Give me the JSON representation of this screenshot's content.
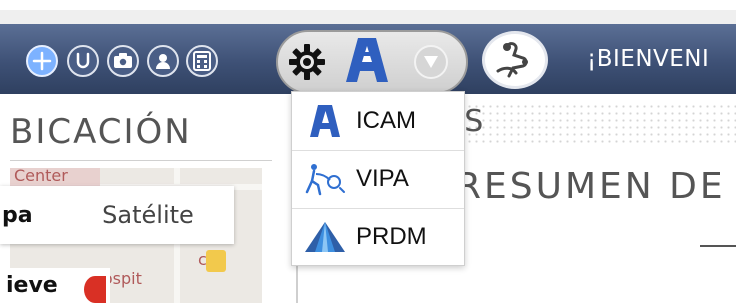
{
  "toolbar": {
    "icons": [
      {
        "name": "add-icon"
      },
      {
        "name": "u-circle-icon"
      },
      {
        "name": "camera-icon"
      },
      {
        "name": "user-icon"
      },
      {
        "name": "calculator-icon"
      }
    ],
    "settings_icon": "gear-icon",
    "logo_icon": "icam-logo-icon",
    "dropdown_icon": "chevron-down-icon",
    "doctor_icon": "doctor-icon",
    "welcome_text": "¡BIENVENI"
  },
  "colors": {
    "navbar_top": "#5b6f95",
    "navbar_bottom": "#2f4060",
    "accent_blue": "#2f5fbf",
    "active_icon": "#7db2ff",
    "menu_text": "#111111"
  },
  "sections": {
    "left_title": "BICACIÓN",
    "right_title": "GS",
    "summary_title": "RESUMEN DE"
  },
  "map": {
    "top_text": "Center",
    "hospital_text": "Michigan Hospit",
    "overlay_text": "cit",
    "map_type_left": "pa",
    "map_type_right": "Satélite",
    "bottom_left_text": "ieve"
  },
  "dropdown_menu": {
    "items": [
      {
        "label": "ICAM",
        "icon": "icam-logo-icon"
      },
      {
        "label": "VIPA",
        "icon": "vipa-icon"
      },
      {
        "label": "PRDM",
        "icon": "prdm-icon"
      }
    ]
  }
}
